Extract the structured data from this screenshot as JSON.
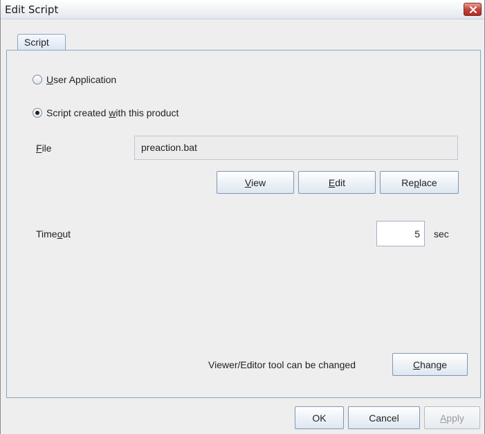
{
  "window": {
    "title": "Edit Script"
  },
  "tab": {
    "label": "Script"
  },
  "options": {
    "user_app": {
      "mnemonic": "U",
      "rest": "ser Application",
      "checked": false
    },
    "script_created": {
      "before": "Script created ",
      "mnemonic": "w",
      "rest": "ith this product",
      "checked": true
    }
  },
  "file": {
    "mnemonic": "F",
    "rest": "ile",
    "value": "preaction.bat"
  },
  "buttons": {
    "view": {
      "mnemonic": "V",
      "rest": "iew"
    },
    "edit": {
      "mnemonic": "E",
      "rest": "dit"
    },
    "replace": {
      "before": "Re",
      "mnemonic": "p",
      "rest": "lace"
    }
  },
  "timeout": {
    "before": "Time",
    "mnemonic": "o",
    "rest": "ut",
    "value": "5",
    "unit": "sec"
  },
  "viewer_note": "Viewer/Editor tool can be changed",
  "change_button": {
    "mnemonic": "C",
    "rest": "hange"
  },
  "footer": {
    "ok": "OK",
    "cancel": "Cancel",
    "apply_mnemonic": "A",
    "apply_rest": "pply"
  }
}
